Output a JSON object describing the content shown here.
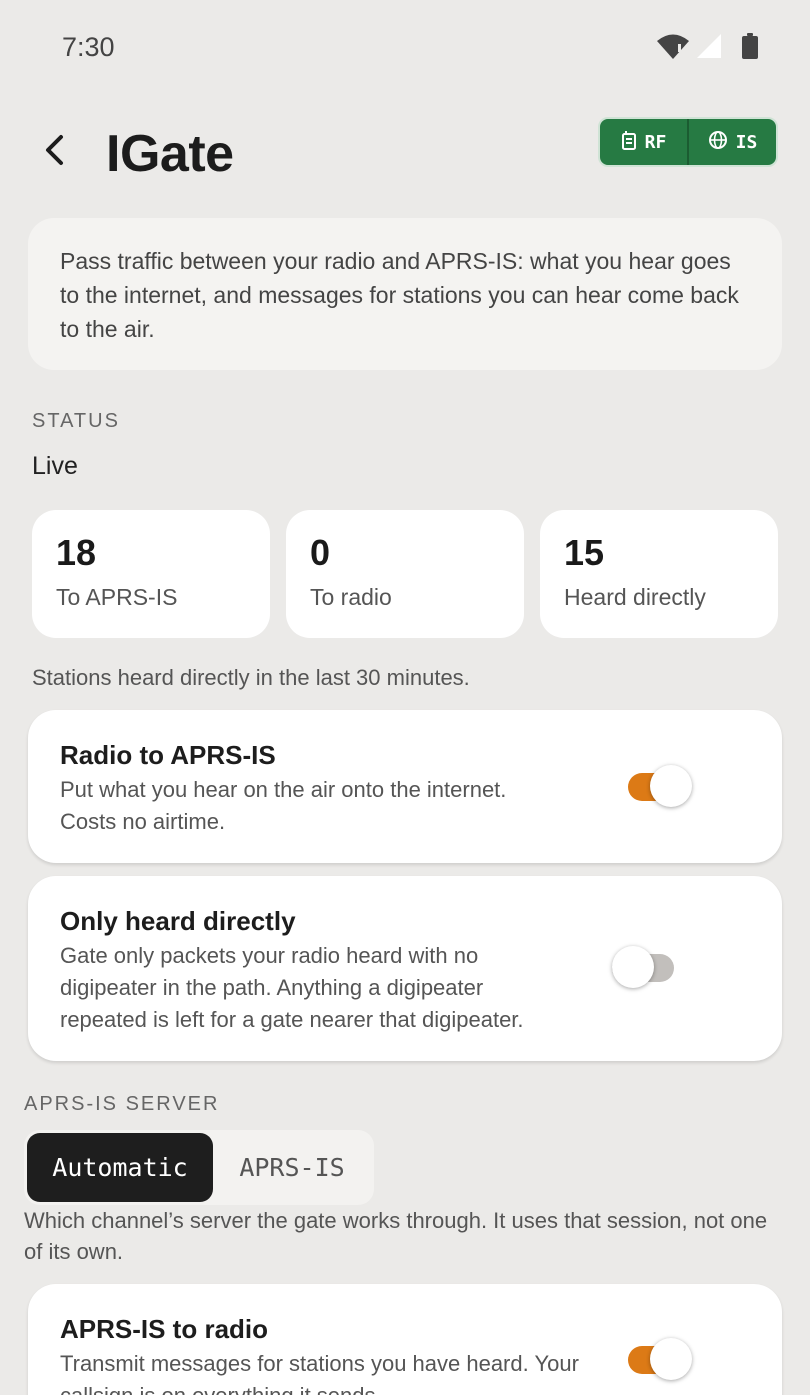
{
  "status_bar": {
    "time": "7:30",
    "icons": [
      "wifi-alert-icon",
      "cellular-signal-icon",
      "battery-icon"
    ]
  },
  "header": {
    "back_icon": "chevron-left-icon",
    "title": "IGate"
  },
  "mode_pill": {
    "rf_label": "RF",
    "rf_icon": "radio-icon",
    "is_label": "IS",
    "is_icon": "globe-icon",
    "color": "#267a43"
  },
  "intro": {
    "text": "Pass traffic between your radio and APRS-IS: what you hear goes to the internet, and messages for stations you can hear come back to the air."
  },
  "status": {
    "section_label": "STATUS",
    "value": "Live",
    "stats": [
      {
        "number": "18",
        "label": "To APRS-IS"
      },
      {
        "number": "0",
        "label": "To radio"
      },
      {
        "number": "15",
        "label": "Heard directly"
      }
    ],
    "footnote": "Stations heard directly in the last 30 minutes."
  },
  "settings": {
    "radio_to_is": {
      "title": "Radio to APRS-IS",
      "description": "Put what you hear on the air onto the internet. Costs no airtime.",
      "enabled": true
    },
    "heard_directly": {
      "title": "Only heard directly",
      "description": "Gate only packets your radio heard with no digipeater in the path. Anything a digipeater repeated is left for a gate nearer that digipeater.",
      "enabled": false
    },
    "is_to_radio": {
      "title": "APRS-IS to radio",
      "description": "Transmit messages for stations you have heard. Your callsign is on everything it sends.",
      "enabled": true
    }
  },
  "server": {
    "section_label": "APRS-IS SERVER",
    "options": [
      "Automatic",
      "APRS-IS"
    ],
    "selected": "Automatic",
    "help": "Which channel’s server the gate works through. It uses that session, not one of its own."
  },
  "colors": {
    "accent": "#dc7a16",
    "background": "#ebeae8",
    "pill_green": "#267a43"
  }
}
